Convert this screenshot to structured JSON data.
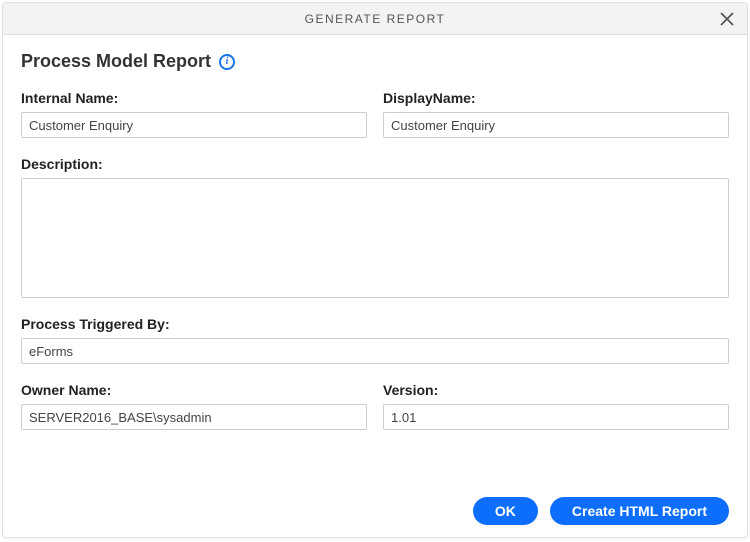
{
  "header": {
    "title": "GENERATE REPORT"
  },
  "section": {
    "title": "Process Model Report"
  },
  "fields": {
    "internalName": {
      "label": "Internal Name:",
      "value": "Customer Enquiry"
    },
    "displayName": {
      "label": "DisplayName:",
      "value": "Customer Enquiry"
    },
    "description": {
      "label": "Description:",
      "value": ""
    },
    "processTriggeredBy": {
      "label": "Process Triggered By:",
      "value": "eForms"
    },
    "ownerName": {
      "label": "Owner Name:",
      "value": "SERVER2016_BASE\\sysadmin"
    },
    "version": {
      "label": "Version:",
      "value": "1.01"
    }
  },
  "buttons": {
    "ok": "OK",
    "createHtmlReport": "Create HTML Report"
  }
}
